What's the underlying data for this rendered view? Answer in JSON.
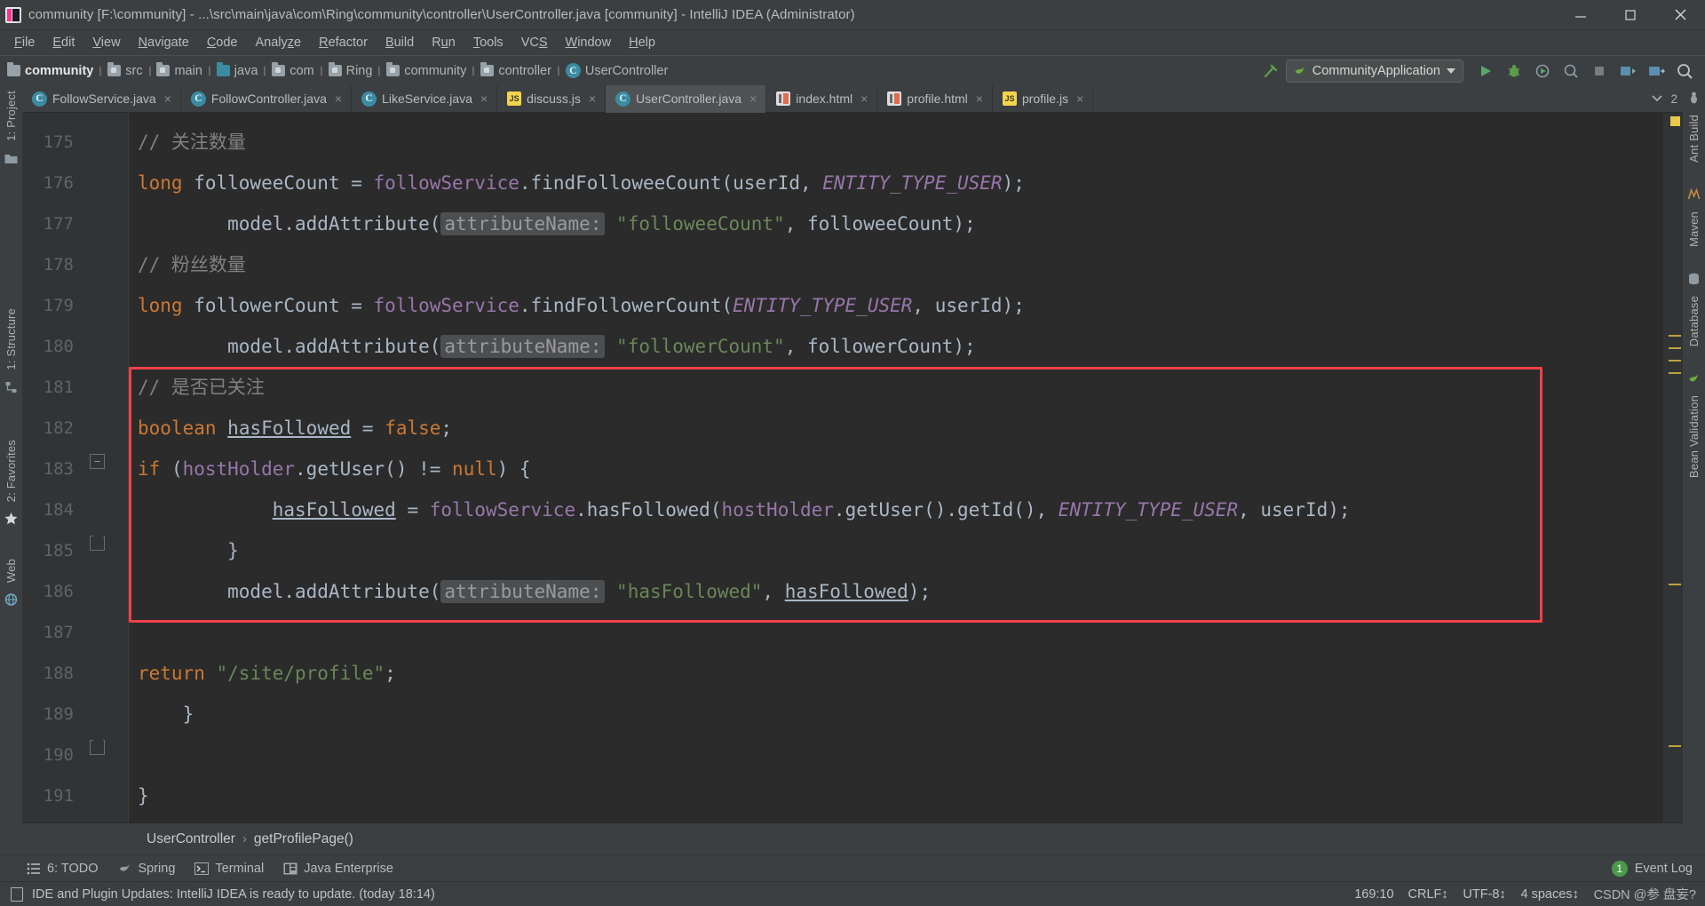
{
  "window": {
    "title": "community [F:\\community] - ...\\src\\main\\java\\com\\Ring\\community\\controller\\UserController.java [community] - IntelliJ IDEA (Administrator)",
    "icon": "intellij-idea-icon",
    "controls": {
      "minimize": "minimize-icon",
      "maximize": "maximize-icon",
      "close": "close-icon"
    }
  },
  "menubar": {
    "items": [
      {
        "label": "File",
        "mnemonic": "F"
      },
      {
        "label": "Edit",
        "mnemonic": "E"
      },
      {
        "label": "View",
        "mnemonic": "V"
      },
      {
        "label": "Navigate",
        "mnemonic": "N"
      },
      {
        "label": "Code",
        "mnemonic": "C"
      },
      {
        "label": "Analyze",
        "mnemonic": "z"
      },
      {
        "label": "Refactor",
        "mnemonic": "R"
      },
      {
        "label": "Build",
        "mnemonic": "B"
      },
      {
        "label": "Run",
        "mnemonic": "u"
      },
      {
        "label": "Tools",
        "mnemonic": "T"
      },
      {
        "label": "VCS",
        "mnemonic": ""
      },
      {
        "label": "Window",
        "mnemonic": "W"
      },
      {
        "label": "Help",
        "mnemonic": "H"
      }
    ]
  },
  "navbar": {
    "breadcrumbs": [
      {
        "label": "community",
        "icon": "folder-icon"
      },
      {
        "label": "src",
        "icon": "folder-icon"
      },
      {
        "label": "main",
        "icon": "folder-icon"
      },
      {
        "label": "java",
        "icon": "source-folder-icon"
      },
      {
        "label": "com",
        "icon": "package-icon"
      },
      {
        "label": "Ring",
        "icon": "package-icon"
      },
      {
        "label": "community",
        "icon": "package-icon"
      },
      {
        "label": "controller",
        "icon": "package-icon"
      },
      {
        "label": "UserController",
        "icon": "java-class-icon"
      }
    ],
    "run_config": {
      "label": "CommunityApplication",
      "icon": "spring-boot-icon"
    },
    "buttons": [
      "build-hammer-icon",
      "run-icon",
      "debug-icon",
      "run-with-coverage-icon",
      "profiler-icon",
      "stop-icon",
      "git-update-icon",
      "git-commit-icon",
      "search-icon"
    ]
  },
  "tabs": {
    "items": [
      {
        "label": "FollowService.java",
        "icon": "java-class-icon",
        "active": false
      },
      {
        "label": "FollowController.java",
        "icon": "java-class-icon",
        "active": false
      },
      {
        "label": "LikeService.java",
        "icon": "java-class-icon",
        "active": false
      },
      {
        "label": "discuss.js",
        "icon": "javascript-icon",
        "active": false
      },
      {
        "label": "UserController.java",
        "icon": "java-class-icon",
        "active": true
      },
      {
        "label": "index.html",
        "icon": "html-icon",
        "active": false
      },
      {
        "label": "profile.html",
        "icon": "html-icon",
        "active": false
      },
      {
        "label": "profile.js",
        "icon": "javascript-icon",
        "active": false
      }
    ],
    "close_label": "×",
    "overflow_count": "2"
  },
  "editor": {
    "first_line": 175,
    "lines": [
      {
        "n": "175",
        "segments": [
          {
            "t": "        ",
            "c": ""
          },
          {
            "t": "// 关注数量",
            "c": "cm"
          }
        ]
      },
      {
        "n": "176",
        "segments": [
          {
            "t": "        ",
            "c": ""
          },
          {
            "t": "long",
            "c": "kw"
          },
          {
            "t": " followeeCount = ",
            "c": ""
          },
          {
            "t": "followService",
            "c": "fld"
          },
          {
            "t": ".findFolloweeCount(userId, ",
            "c": ""
          },
          {
            "t": "ENTITY_TYPE_USER",
            "c": "stc"
          },
          {
            "t": ");",
            "c": ""
          }
        ]
      },
      {
        "n": "177",
        "segments": [
          {
            "t": "        model.addAttribute(",
            "c": ""
          },
          {
            "t": "attributeName:",
            "c": "hint"
          },
          {
            "t": " ",
            "c": ""
          },
          {
            "t": "\"followeeCount\"",
            "c": "str"
          },
          {
            "t": ", followeeCount);",
            "c": ""
          }
        ]
      },
      {
        "n": "178",
        "segments": [
          {
            "t": "        ",
            "c": ""
          },
          {
            "t": "// 粉丝数量",
            "c": "cm"
          }
        ]
      },
      {
        "n": "179",
        "segments": [
          {
            "t": "        ",
            "c": ""
          },
          {
            "t": "long",
            "c": "kw"
          },
          {
            "t": " followerCount = ",
            "c": ""
          },
          {
            "t": "followService",
            "c": "fld"
          },
          {
            "t": ".findFollowerCount(",
            "c": ""
          },
          {
            "t": "ENTITY_TYPE_USER",
            "c": "stc"
          },
          {
            "t": ", userId);",
            "c": ""
          }
        ]
      },
      {
        "n": "180",
        "segments": [
          {
            "t": "        model.addAttribute(",
            "c": ""
          },
          {
            "t": "attributeName:",
            "c": "hint"
          },
          {
            "t": " ",
            "c": ""
          },
          {
            "t": "\"followerCount\"",
            "c": "str"
          },
          {
            "t": ", followerCount);",
            "c": ""
          }
        ]
      },
      {
        "n": "181",
        "segments": [
          {
            "t": "        ",
            "c": ""
          },
          {
            "t": "// 是否已关注",
            "c": "cm"
          }
        ]
      },
      {
        "n": "182",
        "segments": [
          {
            "t": "        ",
            "c": ""
          },
          {
            "t": "boolean",
            "c": "kw"
          },
          {
            "t": " ",
            "c": ""
          },
          {
            "t": "hasFollowed",
            "c": "u"
          },
          {
            "t": " = ",
            "c": ""
          },
          {
            "t": "false",
            "c": "kw"
          },
          {
            "t": ";",
            "c": ""
          }
        ]
      },
      {
        "n": "183",
        "segments": [
          {
            "t": "        ",
            "c": ""
          },
          {
            "t": "if",
            "c": "kw"
          },
          {
            "t": " (",
            "c": ""
          },
          {
            "t": "hostHolder",
            "c": "fld"
          },
          {
            "t": ".getUser() != ",
            "c": ""
          },
          {
            "t": "null",
            "c": "kw"
          },
          {
            "t": ") {",
            "c": ""
          }
        ]
      },
      {
        "n": "184",
        "segments": [
          {
            "t": "            ",
            "c": ""
          },
          {
            "t": "hasFollowed",
            "c": "u"
          },
          {
            "t": " = ",
            "c": ""
          },
          {
            "t": "followService",
            "c": "fld"
          },
          {
            "t": ".hasFollowed(",
            "c": ""
          },
          {
            "t": "hostHolder",
            "c": "fld"
          },
          {
            "t": ".getUser().getId(), ",
            "c": ""
          },
          {
            "t": "ENTITY_TYPE_USER",
            "c": "stc"
          },
          {
            "t": ", userId);",
            "c": ""
          }
        ]
      },
      {
        "n": "185",
        "segments": [
          {
            "t": "        }",
            "c": ""
          }
        ]
      },
      {
        "n": "186",
        "segments": [
          {
            "t": "        model.addAttribute(",
            "c": ""
          },
          {
            "t": "attributeName:",
            "c": "hint"
          },
          {
            "t": " ",
            "c": ""
          },
          {
            "t": "\"hasFollowed\"",
            "c": "str"
          },
          {
            "t": ", ",
            "c": ""
          },
          {
            "t": "hasFollowed",
            "c": "u"
          },
          {
            "t": ");",
            "c": ""
          }
        ]
      },
      {
        "n": "187",
        "segments": [
          {
            "t": "",
            "c": ""
          }
        ]
      },
      {
        "n": "188",
        "segments": [
          {
            "t": "        ",
            "c": ""
          },
          {
            "t": "return",
            "c": "kw"
          },
          {
            "t": " ",
            "c": ""
          },
          {
            "t": "\"/site/profile\"",
            "c": "str"
          },
          {
            "t": ";",
            "c": ""
          }
        ]
      },
      {
        "n": "189",
        "segments": [
          {
            "t": "    }",
            "c": ""
          }
        ]
      },
      {
        "n": "190",
        "segments": [
          {
            "t": "",
            "c": ""
          }
        ]
      },
      {
        "n": "191",
        "segments": [
          {
            "t": "}",
            "c": ""
          }
        ]
      }
    ],
    "annotation": {
      "type": "red-rectangle",
      "color": "#f0404a",
      "covers_lines": "181-186"
    },
    "breadcrumb": {
      "class": "UserController",
      "separator": "›",
      "method": "getProfilePage()"
    }
  },
  "left_strip": {
    "items": [
      {
        "label": "1: Project",
        "mnemonic": "1"
      },
      {
        "label": "1: Structure",
        "mnemonic": "1"
      },
      {
        "label": "2: Favorites",
        "mnemonic": "2"
      },
      {
        "label": "Web",
        "mnemonic": ""
      }
    ],
    "icons": [
      "project-folder-icon",
      "structure-icon",
      "favorites-star-icon",
      "web-globe-icon"
    ]
  },
  "right_strip": {
    "items": [
      {
        "label": "Ant Build"
      },
      {
        "label": "Maven"
      },
      {
        "label": "Database"
      },
      {
        "label": "Bean Validation"
      }
    ],
    "icons": [
      "ant-icon",
      "maven-icon",
      "database-icon",
      "bean-validation-icon"
    ]
  },
  "bottombar": {
    "items": [
      {
        "label": "6: TODO",
        "mnemonic": "6",
        "icon": "todo-list-icon"
      },
      {
        "label": "Spring",
        "mnemonic": "",
        "icon": "spring-leaf-icon"
      },
      {
        "label": "Terminal",
        "mnemonic": "",
        "icon": "terminal-icon"
      },
      {
        "label": "Java Enterprise",
        "mnemonic": "",
        "icon": "java-enterprise-icon"
      }
    ],
    "event_log": {
      "label": "Event Log",
      "badge": "1"
    }
  },
  "statusbar": {
    "message": "IDE and Plugin Updates: IntelliJ IDEA is ready to update. (today 18:14)",
    "message_icon": "notification-icon",
    "caret_position": "169:10",
    "line_separator": "CRLF",
    "encoding": "UTF-8",
    "indent": "4 spaces",
    "watermark": "CSDN @参 盘妄?"
  },
  "colors": {
    "bg_chrome": "#3c3f41",
    "bg_editor": "#2b2b2b",
    "gutter": "#313335",
    "accent_red": "#f0404a",
    "keyword": "#cc7832",
    "string": "#6a8759",
    "field": "#9876aa",
    "comment": "#808080",
    "text": "#a9b7c6",
    "tab_active": "#4e5254"
  }
}
